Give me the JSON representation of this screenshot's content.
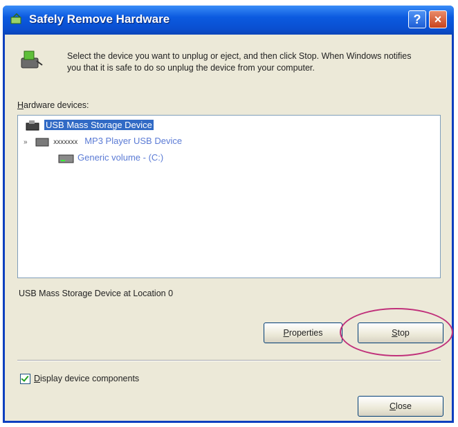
{
  "window": {
    "title": "Safely Remove Hardware",
    "help_label": "?",
    "close_label": "×"
  },
  "instructions": "Select the device you want to unplug or eject, and then click Stop. When Windows notifies you that it is safe to do so unplug the device from your computer.",
  "hardware_devices": {
    "label_accel": "H",
    "label_rest": "ardware devices:",
    "items": [
      {
        "label": "USB Mass Storage Device",
        "selected": true,
        "icon": "usb-storage-icon"
      },
      {
        "prefix": "xxxxxxx",
        "label": "MP3 Player USB Device",
        "icon": "drive-icon"
      },
      {
        "label": "Generic volume - (C:)",
        "icon": "volume-icon"
      }
    ]
  },
  "status_text": "USB Mass Storage Device at Location 0",
  "buttons": {
    "properties_accel": "P",
    "properties_rest": "roperties",
    "stop_accel": "S",
    "stop_rest": "top",
    "close_accel": "C",
    "close_rest": "lose"
  },
  "display_components": {
    "accel": "D",
    "rest": "isplay device components",
    "checked": true
  },
  "colors": {
    "title_bar": "#0a4fd0",
    "selection": "#316ac5",
    "highlight_ring": "#c0307a"
  }
}
